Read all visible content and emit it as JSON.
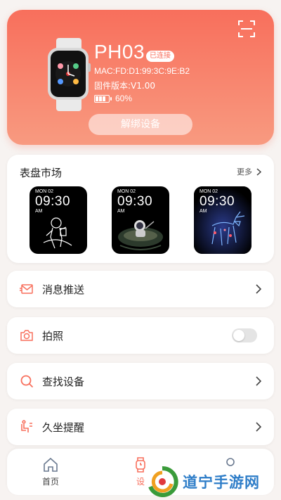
{
  "device": {
    "name": "PH03",
    "status": "已连接",
    "mac": "MAC:FD:D1:99:3C:9E:B2",
    "firmware": "固件版本:V1.00",
    "battery": "60%",
    "battery_level": 0.6,
    "unbind_label": "解绑设备"
  },
  "market": {
    "title": "表盘市场",
    "more_label": "更多",
    "faces": [
      {
        "date": "MON 02",
        "time": "09:30",
        "ampm": "AM",
        "theme": "astronaut-line"
      },
      {
        "date": "MON 02",
        "time": "09:30",
        "ampm": "AM",
        "theme": "astronaut-boat"
      },
      {
        "date": "MON 02",
        "time": "09:30",
        "ampm": "AM",
        "theme": "neon-deer"
      }
    ]
  },
  "rows": {
    "push": {
      "label": "消息推送",
      "icon": "envelope-icon"
    },
    "photo": {
      "label": "拍照",
      "icon": "camera-icon",
      "toggle": false
    },
    "find": {
      "label": "查找设备",
      "icon": "search-icon"
    },
    "sedentary": {
      "label": "久坐提醒",
      "icon": "sitting-person-icon"
    }
  },
  "nav": {
    "home_label": "首页",
    "device_label": "设",
    "active": "device"
  },
  "watermark": {
    "text": "道宁手游网"
  },
  "colors": {
    "accent": "#f86f5c",
    "accent_light": "#f89a80",
    "background": "#f7f3f1"
  }
}
